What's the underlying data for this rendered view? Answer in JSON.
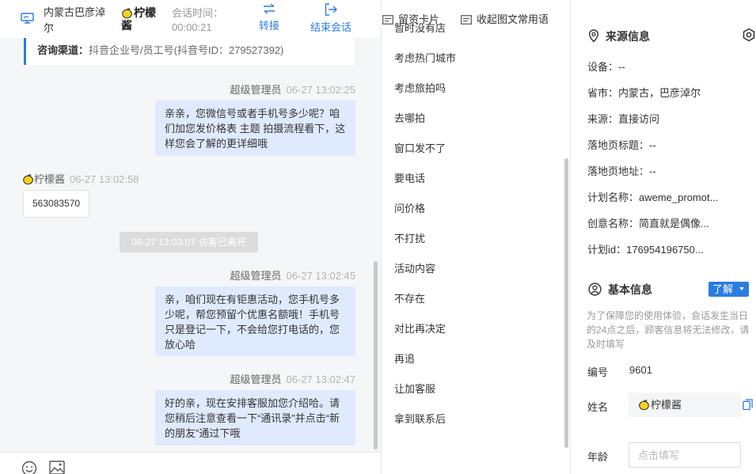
{
  "header": {
    "location": "内蒙古巴彦淖尔",
    "customer_name": "柠檬酱",
    "session_time_label": "会话时间：",
    "session_time_value": "00:00:21",
    "transfer_label": "转接",
    "end_session_label": "结束会话"
  },
  "channel": {
    "label": "咨询渠道：",
    "value": "抖音企业号/员工号(抖音号ID：279527392)"
  },
  "messages": [
    {
      "sender": "超级管理员",
      "time": "06-27 13:02:25",
      "text": "亲亲，您微信号或者手机号多少呢？咱们加您发价格表 主题 拍摄流程看下，这样您会了解的更详细哦"
    },
    {
      "sender": "柠檬酱",
      "time": "06-27 13:02:58",
      "text": "563083570"
    },
    {
      "system_time": "06-27 13:03:07",
      "system_text": "访客已离开"
    },
    {
      "sender": "超级管理员",
      "time": "06-27 13:02:45",
      "text": "亲，咱们现在有钜惠活动，您手机号多少呢，帮您预留个优惠名额哦！手机号只是登记一下，不会给您打电话的，您放心哈"
    },
    {
      "sender": "超级管理员",
      "time": "06-27 13:02:47",
      "text": "好的亲，现在安排客服加您介绍哈。请您稍后注意查看一下“通讯录”并点击“新的朋友”通过下哦"
    }
  ],
  "phrases": [
    "暂时没有店",
    "考虑热门城市",
    "考虑旅拍吗",
    "去哪拍",
    "窗口发不了",
    "要电话",
    "问价格",
    "不打扰",
    "活动内容",
    "不存在",
    "对比再决定",
    "再追",
    "让加客服",
    "拿到联系后"
  ],
  "footer": {
    "card_label": "留资卡片",
    "collapse_label": "收起图文常用语"
  },
  "source_info": {
    "title": "来源信息",
    "rows": [
      "设备：--",
      "省市：内蒙古，巴彦淖尔",
      "来源：直接访问",
      "落地页标题：--",
      "落地页地址：--",
      "计划名称：aweme_promot...",
      "创意名称：简直就是偶像...",
      "计划id：176954196750..."
    ]
  },
  "basic_info": {
    "title": "基本信息",
    "learn_label": "了解",
    "notice": "为了保障您的使用体验，会话发生当日的24点之后，顾客信息将无法修改，请及时填写",
    "id_label": "编号",
    "id_value": "9601",
    "name_label": "姓名",
    "name_value": "柠檬酱",
    "age_label": "年龄",
    "age_placeholder": "点击填写"
  },
  "colors": {
    "accent": "#2a7de1",
    "bubble": "#dfeaff",
    "chat_bg": "#f5f6f7",
    "lemon": "#f5d21c"
  }
}
